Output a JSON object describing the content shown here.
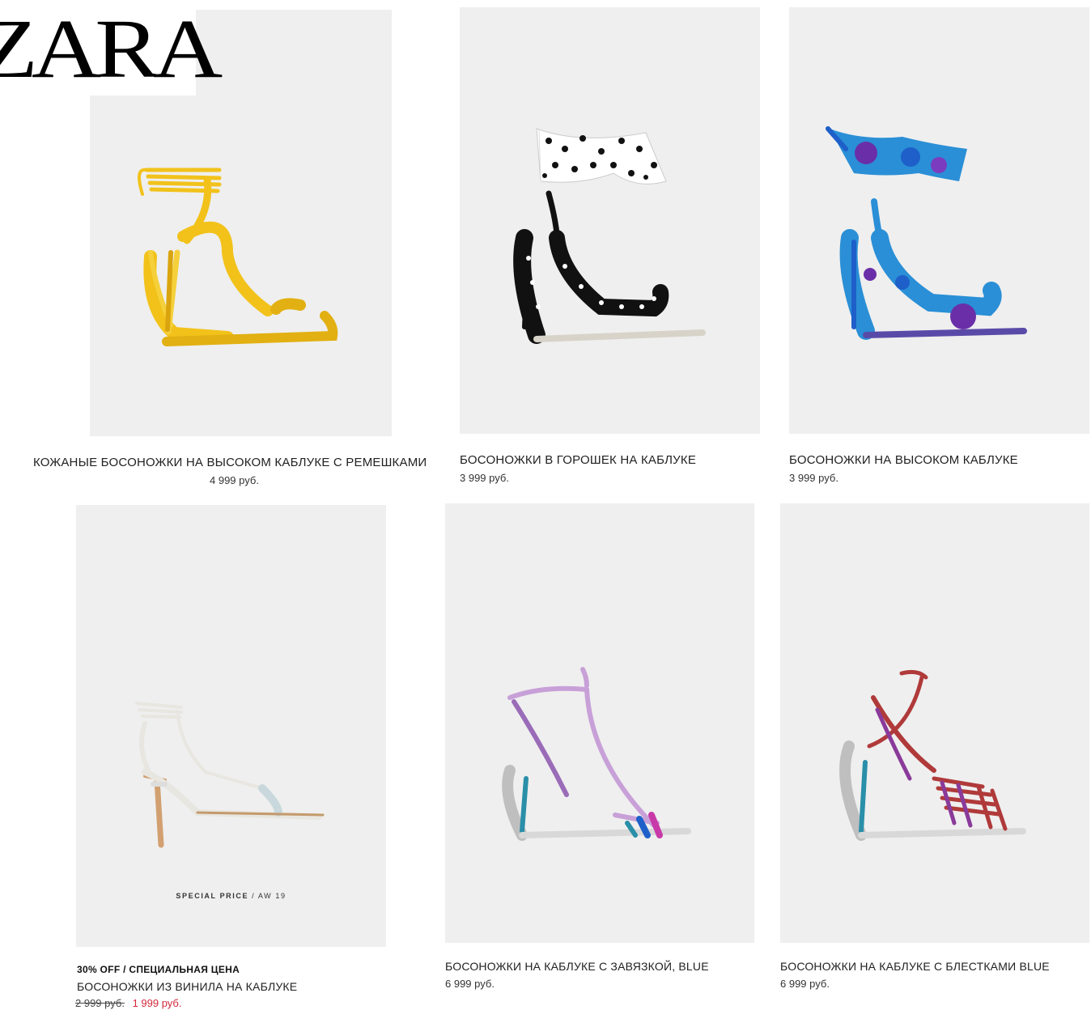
{
  "brand": {
    "logo_text": "ZARA"
  },
  "products": [
    {
      "title": "КОЖАНЫЕ БОСОНОЖКИ НА ВЫСОКОМ КАБЛУКЕ С РЕМЕШКАМИ",
      "price": "4 999 руб.",
      "color": "#f2c21b"
    },
    {
      "title": "БОСОНОЖКИ В ГОРОШЕК НА КАБЛУКЕ",
      "price": "3 999 руб.",
      "color": "#111111"
    },
    {
      "title": "БОСОНОЖКИ НА ВЫСОКОМ КАБЛУКЕ",
      "price": "3 999 руб.",
      "color": "#2a8fd6"
    },
    {
      "promo": "30% OFF / СПЕЦИАЛЬНАЯ ЦЕНА",
      "title": "БОСОНОЖКИ ИЗ ВИНИЛА НА КАБЛУКЕ",
      "old_price": "2 999 руб.",
      "new_price": "1 999 руб.",
      "overlay_bold": "SPECIAL PRICE",
      "overlay_rest": " / AW 19",
      "color": "#e8e6e0"
    },
    {
      "title": "БОСОНОЖКИ НА КАБЛУКЕ С ЗАВЯЗКОЙ, BLUE",
      "price": "6 999 руб.",
      "color": "#c8a0d8"
    },
    {
      "title": "БОСОНОЖКИ НА КАБЛУКЕ С БЛЕСТКАМИ BLUE",
      "price": "6 999 руб.",
      "color": "#b03a3a"
    }
  ]
}
